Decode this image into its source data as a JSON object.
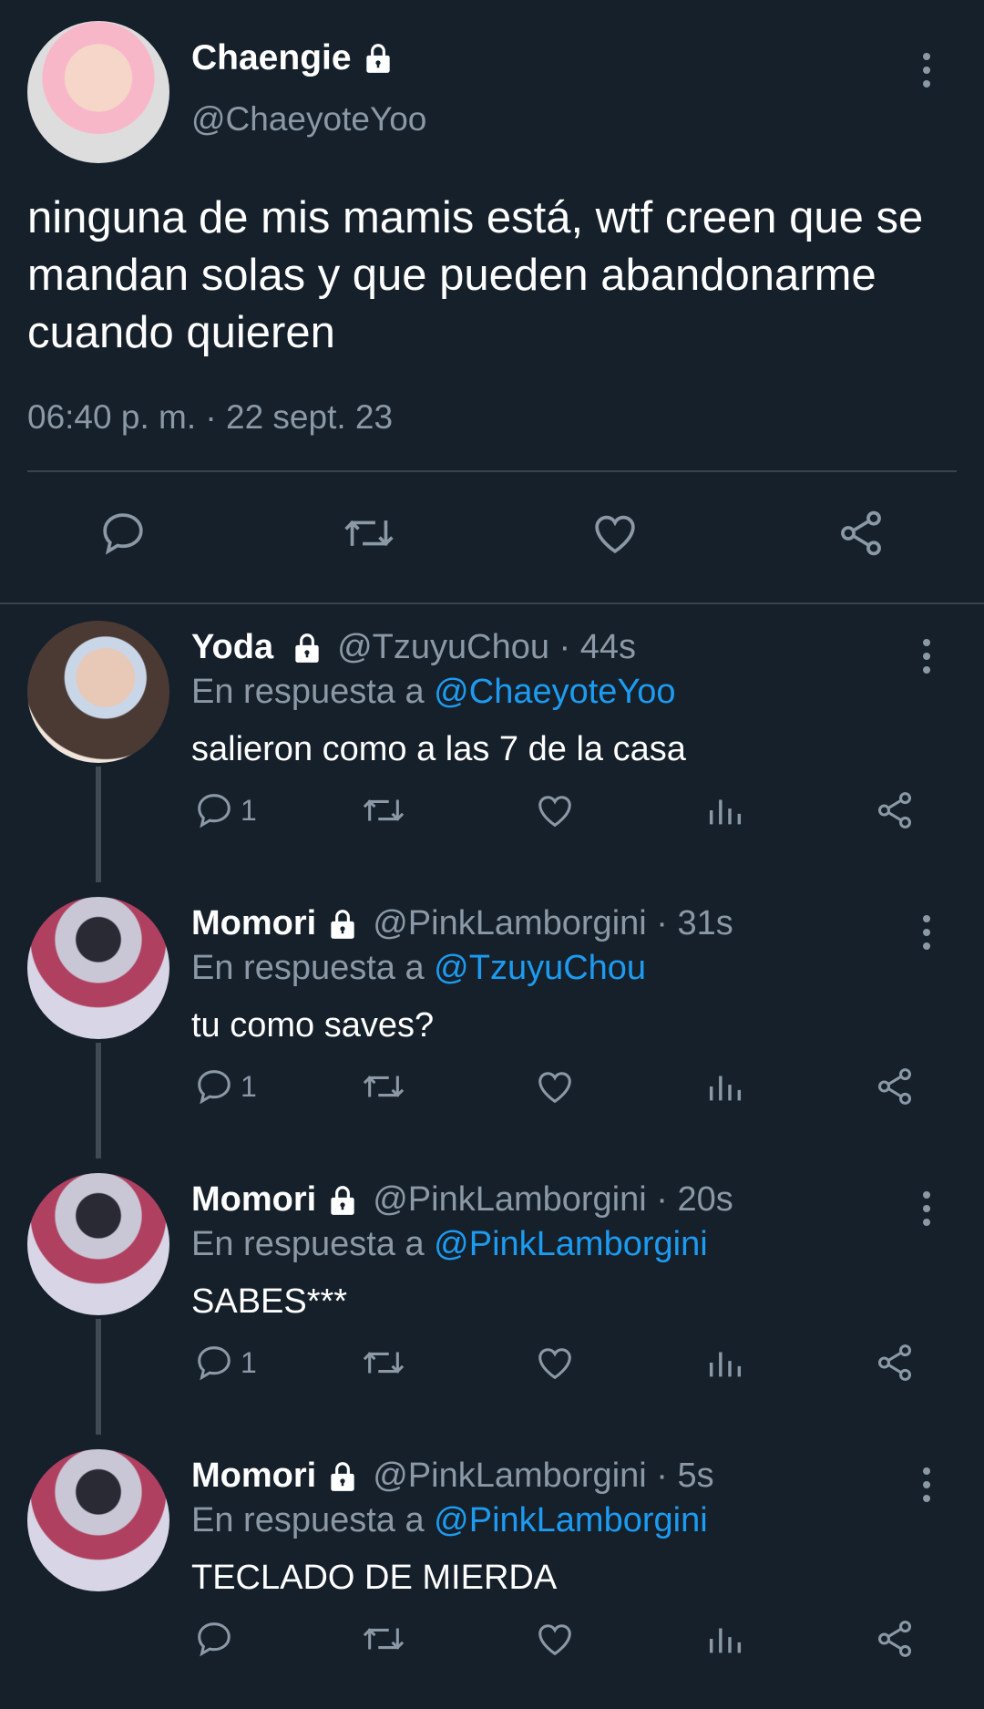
{
  "main_tweet": {
    "name": "Chaengie",
    "handle": "@ChaeyoteYoo",
    "text": "ninguna de mis mamis está, wtf creen que se mandan solas y que pueden abandonarme cuando quieren",
    "timestamp": "06:40 p. m. · 22 sept. 23"
  },
  "replies": [
    {
      "name": "Yoda",
      "handle_time": "@TzuyuChou · 44s",
      "in_reply_prefix": "En respuesta a ",
      "in_reply_to": "@ChaeyoteYoo",
      "text": "salieron como a las 7 de la casa",
      "reply_count": "1"
    },
    {
      "name": "Momori",
      "handle_time": "@PinkLamborgini · 31s",
      "in_reply_prefix": "En respuesta a ",
      "in_reply_to": "@TzuyuChou",
      "text": "tu como saves?",
      "reply_count": "1"
    },
    {
      "name": "Momori",
      "handle_time": "@PinkLamborgini · 20s",
      "in_reply_prefix": "En respuesta a ",
      "in_reply_to": "@PinkLamborgini",
      "text": "SABES***",
      "reply_count": "1"
    },
    {
      "name": "Momori",
      "handle_time": "@PinkLamborgini · 5s",
      "in_reply_prefix": "En respuesta a ",
      "in_reply_to": "@PinkLamborgini",
      "text": "TECLADO DE MIERDA",
      "reply_count": ""
    }
  ],
  "colors": {
    "background": "#15202b",
    "secondary_text": "#8b98a5",
    "mention": "#1d9bf0",
    "divider": "#38444d"
  },
  "icons": [
    "lock-icon",
    "more-icon",
    "reply-icon",
    "retweet-icon",
    "like-icon",
    "share-icon",
    "analytics-icon"
  ]
}
